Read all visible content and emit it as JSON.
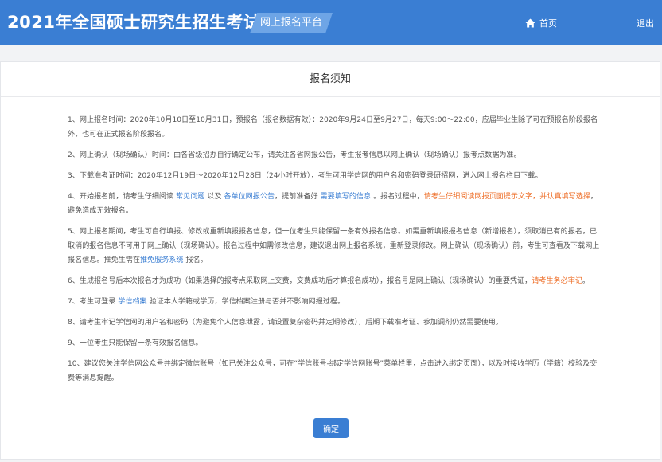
{
  "header": {
    "title": "2021年全国硕士研究生招生考试",
    "platform_label": "网上报名平台",
    "home_label": "首页",
    "home_icon": "home-icon",
    "logout_label": "退出",
    "colors": {
      "bar": "#3a7ed3",
      "platform_tab": "#6ea5e6"
    }
  },
  "panel": {
    "title": "报名须知",
    "notices": [
      {
        "parts": [
          {
            "text": "1、网上报名时间：2020年10月10日至10月31日，预报名（报名数据有效）：2020年9月24日至9月27日，每天9:00～22:00，应届毕业生除了可在预报名阶段报名外，也可在正式报名阶段报名。"
          }
        ]
      },
      {
        "parts": [
          {
            "text": "2、网上确认（现场确认）时间：由各省级招办自行确定公布，请关注各省网报公告，考生报考信息以网上确认（现场确认）报考点数据为准。"
          }
        ]
      },
      {
        "parts": [
          {
            "text": "3、下载准考证时间：2020年12月19日～2020年12月28日（24小时开放），考生可用学信网的用户名和密码登录研招网，进入网上报名栏目下载。"
          }
        ]
      },
      {
        "parts": [
          {
            "text": "4、开始报名前，请考生仔细阅读 "
          },
          {
            "text": "常见问题",
            "style": "link"
          },
          {
            "text": " 以及 "
          },
          {
            "text": "各单位网报公告",
            "style": "link"
          },
          {
            "text": "，提前准备好 "
          },
          {
            "text": "需要填写的信息",
            "style": "link"
          },
          {
            "text": " 。报名过程中，"
          },
          {
            "text": "请考生仔细阅读网报页面提示文字，并认真填写选择",
            "style": "warn"
          },
          {
            "text": "，避免造成无效报名。"
          }
        ]
      },
      {
        "parts": [
          {
            "text": "5、网上报名期间，考生可自行填报、修改或重新填报报名信息，但一位考生只能保留一条有效报名信息。如需重新填报报名信息（新增报名），须取消已有的报名，已取消的报名信息不可用于网上确认（现场确认）。报名过程中如需修改信息，建议退出网上报名系统，重新登录修改。网上确认（现场确认）前，考生可查看及下载网上报名信息。推免生需在"
          },
          {
            "text": "推免服务系统",
            "style": "link"
          },
          {
            "text": " 报名。"
          }
        ]
      },
      {
        "parts": [
          {
            "text": "6、生成报名号后本次报名才为成功（如果选择的报考点采取网上交费，交费成功后才算报名成功），报名号是网上确认（现场确认）的重要凭证，"
          },
          {
            "text": "请考生务必牢记",
            "style": "warn"
          },
          {
            "text": "。"
          }
        ]
      },
      {
        "parts": [
          {
            "text": "7、考生可登录 "
          },
          {
            "text": "学信档案",
            "style": "link"
          },
          {
            "text": " 验证本人学籍或学历，学信档案注册与否并不影响网报过程。"
          }
        ]
      },
      {
        "parts": [
          {
            "text": "8、请考生牢记学信网的用户名和密码（为避免个人信息泄露，请设置复杂密码并定期修改），后期下载准考证、参加调剂仍然需要使用。"
          }
        ]
      },
      {
        "parts": [
          {
            "text": "9、一位考生只能保留一条有效报名信息。"
          }
        ]
      },
      {
        "parts": [
          {
            "text": "10、建议您关注学信网公众号并绑定微信账号（如已关注公众号，可在“学信账号-绑定学信网账号”菜单栏里，点击进入绑定页面），以及时接收学历（学籍）校验及交费等消息提醒。"
          }
        ]
      }
    ],
    "confirm_label": "确定",
    "colors": {
      "link": "#3a7ed3",
      "warning": "#ee6d26"
    }
  }
}
